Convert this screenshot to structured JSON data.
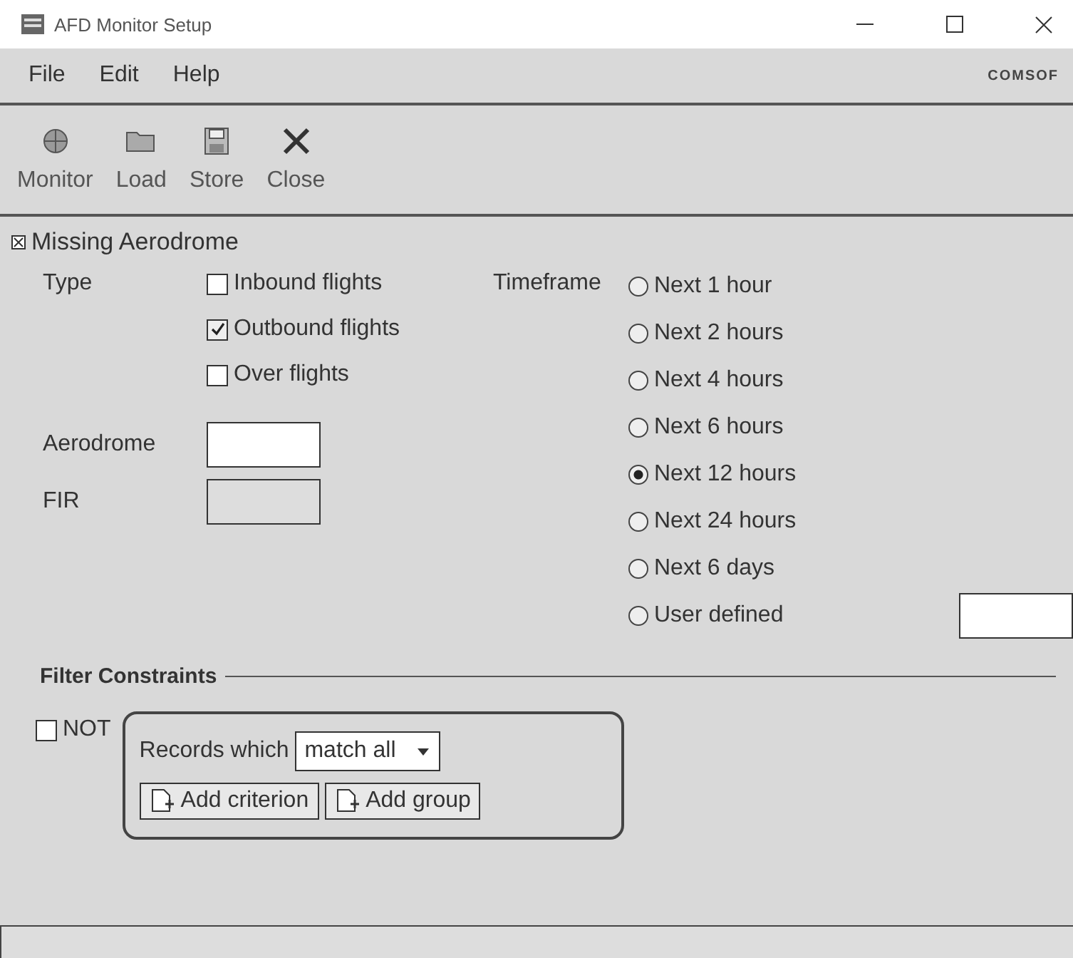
{
  "window": {
    "title": "AFD Monitor Setup"
  },
  "menu": [
    {
      "label": "File"
    },
    {
      "label": "Edit"
    },
    {
      "label": "Help"
    }
  ],
  "logo": "COMSOF",
  "toolbar": [
    {
      "label": "Monitor",
      "kind": "monitor"
    },
    {
      "label": "Load",
      "kind": "load"
    },
    {
      "label": "Store",
      "kind": "store"
    },
    {
      "label": "Close",
      "kind": "close"
    }
  ],
  "section": {
    "title": "Missing Aerodrome"
  },
  "type": {
    "label": "Type",
    "options": [
      {
        "label": "Inbound flights",
        "checked": false
      },
      {
        "label": "Outbound flights",
        "checked": true
      },
      {
        "label": "Over flights",
        "checked": false
      }
    ]
  },
  "aerodrome": {
    "label": "Aerodrome"
  },
  "fir": {
    "label": "FIR"
  },
  "timeframe": {
    "label": "Timeframe",
    "options": [
      {
        "label": "Next 1 hour",
        "selected": false,
        "kind": "plain"
      },
      {
        "label": "Next 2 hours",
        "selected": false,
        "kind": "plain"
      },
      {
        "label": "Next 4 hours",
        "selected": false,
        "kind": "plain"
      },
      {
        "label": "Next 6 hours",
        "selected": false,
        "kind": "plain"
      },
      {
        "label": "Next 12 hours",
        "selected": true,
        "kind": "plain"
      },
      {
        "label": "Next 24 hours",
        "selected": false,
        "kind": "plain"
      },
      {
        "label": "Next 6 days",
        "selected": false,
        "kind": "plain"
      },
      {
        "label": "User defined",
        "selected": false,
        "kind": "field"
      }
    ]
  },
  "filter": {
    "title": "Filter Constraints",
    "not": {
      "label": "NOT",
      "checked": false
    },
    "records_label": "Records which",
    "match": "match all",
    "buttons": [
      {
        "label": "Add criterion"
      },
      {
        "label": "Add group"
      }
    ]
  }
}
